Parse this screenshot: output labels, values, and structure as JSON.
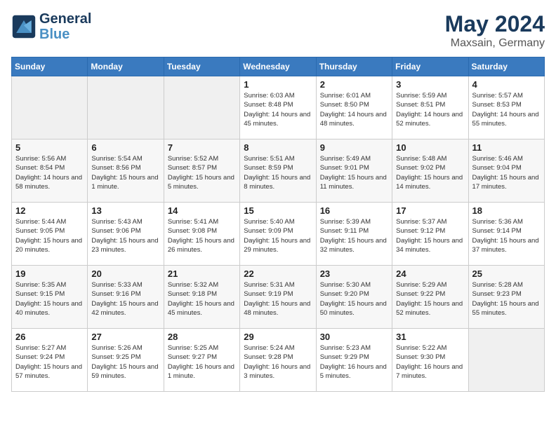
{
  "header": {
    "logo_line1": "General",
    "logo_line2": "Blue",
    "month": "May 2024",
    "location": "Maxsain, Germany"
  },
  "days_of_week": [
    "Sunday",
    "Monday",
    "Tuesday",
    "Wednesday",
    "Thursday",
    "Friday",
    "Saturday"
  ],
  "weeks": [
    [
      {
        "day": "",
        "info": ""
      },
      {
        "day": "",
        "info": ""
      },
      {
        "day": "",
        "info": ""
      },
      {
        "day": "1",
        "info": "Sunrise: 6:03 AM\nSunset: 8:48 PM\nDaylight: 14 hours\nand 45 minutes."
      },
      {
        "day": "2",
        "info": "Sunrise: 6:01 AM\nSunset: 8:50 PM\nDaylight: 14 hours\nand 48 minutes."
      },
      {
        "day": "3",
        "info": "Sunrise: 5:59 AM\nSunset: 8:51 PM\nDaylight: 14 hours\nand 52 minutes."
      },
      {
        "day": "4",
        "info": "Sunrise: 5:57 AM\nSunset: 8:53 PM\nDaylight: 14 hours\nand 55 minutes."
      }
    ],
    [
      {
        "day": "5",
        "info": "Sunrise: 5:56 AM\nSunset: 8:54 PM\nDaylight: 14 hours\nand 58 minutes."
      },
      {
        "day": "6",
        "info": "Sunrise: 5:54 AM\nSunset: 8:56 PM\nDaylight: 15 hours\nand 1 minute."
      },
      {
        "day": "7",
        "info": "Sunrise: 5:52 AM\nSunset: 8:57 PM\nDaylight: 15 hours\nand 5 minutes."
      },
      {
        "day": "8",
        "info": "Sunrise: 5:51 AM\nSunset: 8:59 PM\nDaylight: 15 hours\nand 8 minutes."
      },
      {
        "day": "9",
        "info": "Sunrise: 5:49 AM\nSunset: 9:01 PM\nDaylight: 15 hours\nand 11 minutes."
      },
      {
        "day": "10",
        "info": "Sunrise: 5:48 AM\nSunset: 9:02 PM\nDaylight: 15 hours\nand 14 minutes."
      },
      {
        "day": "11",
        "info": "Sunrise: 5:46 AM\nSunset: 9:04 PM\nDaylight: 15 hours\nand 17 minutes."
      }
    ],
    [
      {
        "day": "12",
        "info": "Sunrise: 5:44 AM\nSunset: 9:05 PM\nDaylight: 15 hours\nand 20 minutes."
      },
      {
        "day": "13",
        "info": "Sunrise: 5:43 AM\nSunset: 9:06 PM\nDaylight: 15 hours\nand 23 minutes."
      },
      {
        "day": "14",
        "info": "Sunrise: 5:41 AM\nSunset: 9:08 PM\nDaylight: 15 hours\nand 26 minutes."
      },
      {
        "day": "15",
        "info": "Sunrise: 5:40 AM\nSunset: 9:09 PM\nDaylight: 15 hours\nand 29 minutes."
      },
      {
        "day": "16",
        "info": "Sunrise: 5:39 AM\nSunset: 9:11 PM\nDaylight: 15 hours\nand 32 minutes."
      },
      {
        "day": "17",
        "info": "Sunrise: 5:37 AM\nSunset: 9:12 PM\nDaylight: 15 hours\nand 34 minutes."
      },
      {
        "day": "18",
        "info": "Sunrise: 5:36 AM\nSunset: 9:14 PM\nDaylight: 15 hours\nand 37 minutes."
      }
    ],
    [
      {
        "day": "19",
        "info": "Sunrise: 5:35 AM\nSunset: 9:15 PM\nDaylight: 15 hours\nand 40 minutes."
      },
      {
        "day": "20",
        "info": "Sunrise: 5:33 AM\nSunset: 9:16 PM\nDaylight: 15 hours\nand 42 minutes."
      },
      {
        "day": "21",
        "info": "Sunrise: 5:32 AM\nSunset: 9:18 PM\nDaylight: 15 hours\nand 45 minutes."
      },
      {
        "day": "22",
        "info": "Sunrise: 5:31 AM\nSunset: 9:19 PM\nDaylight: 15 hours\nand 48 minutes."
      },
      {
        "day": "23",
        "info": "Sunrise: 5:30 AM\nSunset: 9:20 PM\nDaylight: 15 hours\nand 50 minutes."
      },
      {
        "day": "24",
        "info": "Sunrise: 5:29 AM\nSunset: 9:22 PM\nDaylight: 15 hours\nand 52 minutes."
      },
      {
        "day": "25",
        "info": "Sunrise: 5:28 AM\nSunset: 9:23 PM\nDaylight: 15 hours\nand 55 minutes."
      }
    ],
    [
      {
        "day": "26",
        "info": "Sunrise: 5:27 AM\nSunset: 9:24 PM\nDaylight: 15 hours\nand 57 minutes."
      },
      {
        "day": "27",
        "info": "Sunrise: 5:26 AM\nSunset: 9:25 PM\nDaylight: 15 hours\nand 59 minutes."
      },
      {
        "day": "28",
        "info": "Sunrise: 5:25 AM\nSunset: 9:27 PM\nDaylight: 16 hours\nand 1 minute."
      },
      {
        "day": "29",
        "info": "Sunrise: 5:24 AM\nSunset: 9:28 PM\nDaylight: 16 hours\nand 3 minutes."
      },
      {
        "day": "30",
        "info": "Sunrise: 5:23 AM\nSunset: 9:29 PM\nDaylight: 16 hours\nand 5 minutes."
      },
      {
        "day": "31",
        "info": "Sunrise: 5:22 AM\nSunset: 9:30 PM\nDaylight: 16 hours\nand 7 minutes."
      },
      {
        "day": "",
        "info": ""
      }
    ]
  ]
}
